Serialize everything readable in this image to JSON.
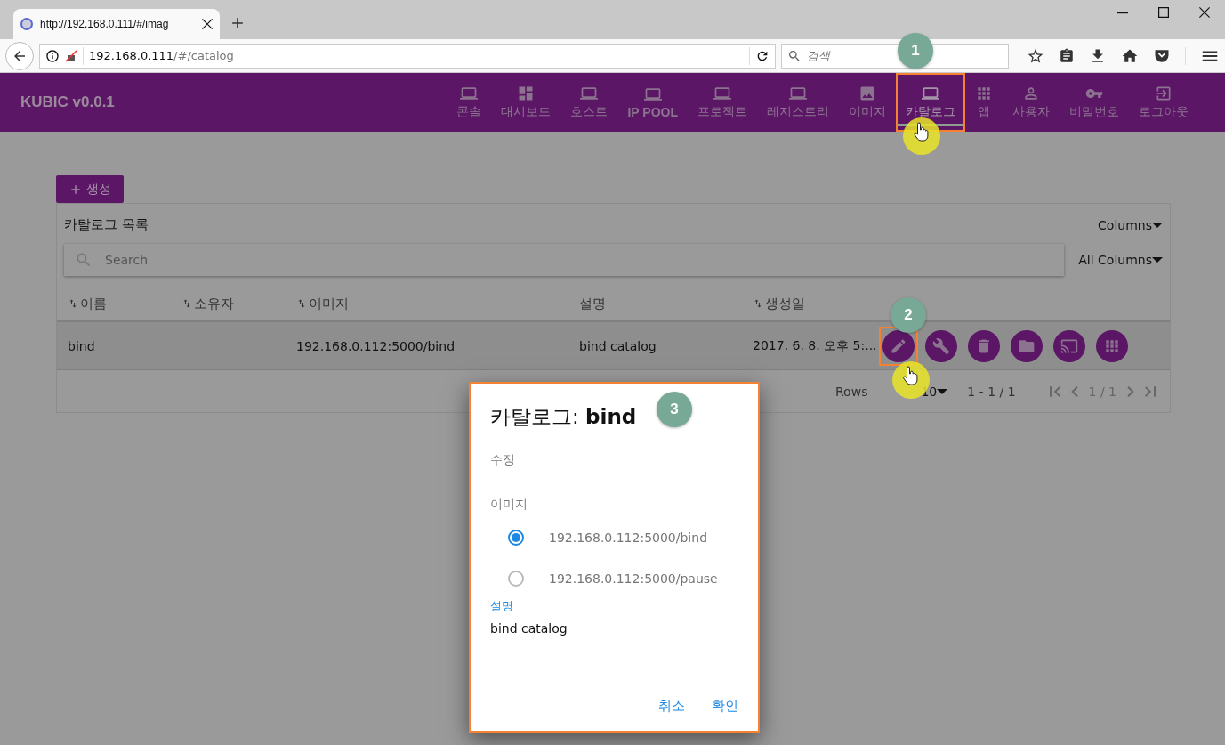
{
  "browser": {
    "tab_title": "http://192.168.0.111/#/imag",
    "url_host": "192.168.0.111",
    "url_path": "/#/catalog",
    "search_placeholder": "검색"
  },
  "app": {
    "title": "KUBIC v0.0.1",
    "nav": [
      {
        "label": "콘솔",
        "kind": "laptop",
        "selected": false,
        "highlighted": false
      },
      {
        "label": "대시보드",
        "kind": "dashboard",
        "selected": false,
        "highlighted": false
      },
      {
        "label": "호스트",
        "kind": "laptop",
        "selected": false,
        "highlighted": false
      },
      {
        "label": "IP POOL",
        "kind": "laptop",
        "selected": false,
        "highlighted": false
      },
      {
        "label": "프로젝트",
        "kind": "laptop",
        "selected": false,
        "highlighted": false
      },
      {
        "label": "레지스트리",
        "kind": "laptop",
        "selected": false,
        "highlighted": false
      },
      {
        "label": "이미지",
        "kind": "image",
        "selected": false,
        "highlighted": false
      },
      {
        "label": "카탈로그",
        "kind": "laptop",
        "selected": true,
        "highlighted": true
      },
      {
        "label": "앱",
        "kind": "grid",
        "selected": false,
        "highlighted": false
      },
      {
        "label": "사용자",
        "kind": "person",
        "selected": false,
        "highlighted": false
      },
      {
        "label": "비밀번호",
        "kind": "key",
        "selected": false,
        "highlighted": false
      },
      {
        "label": "로그아웃",
        "kind": "logout",
        "selected": false,
        "highlighted": false
      }
    ]
  },
  "create_button": "생성",
  "table": {
    "title": "카탈로그 목록",
    "columns_menu": "Columns",
    "search_placeholder": "Search",
    "filter_menu": "All Columns",
    "columns": [
      {
        "label": "이름",
        "sortable": true
      },
      {
        "label": "소유자",
        "sortable": true
      },
      {
        "label": "이미지",
        "sortable": true
      },
      {
        "label": "설명",
        "sortable": false
      },
      {
        "label": "생성일",
        "sortable": true
      }
    ],
    "rows": [
      {
        "cells": [
          "bind",
          "",
          "192.168.0.112:5000/bind",
          "bind catalog",
          "2017. 6. 8. 오후 5:..."
        ]
      }
    ],
    "actions": [
      {
        "kind": "pencil",
        "highlighted": true
      },
      {
        "kind": "wrench",
        "highlighted": false
      },
      {
        "kind": "trash",
        "highlighted": false
      },
      {
        "kind": "folder",
        "highlighted": false
      },
      {
        "kind": "cast",
        "highlighted": false
      },
      {
        "kind": "grid",
        "highlighted": false
      }
    ],
    "footer": {
      "rows_label": "Rows",
      "rows_per_page": "10",
      "range": "1 - 1 / 1",
      "page": "1 / 1"
    }
  },
  "dialog": {
    "title": "카탈로그: **bind**",
    "subtitle": "수정",
    "image_label": "이미지",
    "options": [
      {
        "label": "192.168.0.112:5000/bind",
        "selected": true
      },
      {
        "label": "192.168.0.112:5000/pause",
        "selected": false
      }
    ],
    "description_label": "설명",
    "description_value": "bind catalog",
    "buttons": [
      "취소",
      "확인"
    ]
  },
  "annotations": [
    "1",
    "2",
    "3"
  ]
}
